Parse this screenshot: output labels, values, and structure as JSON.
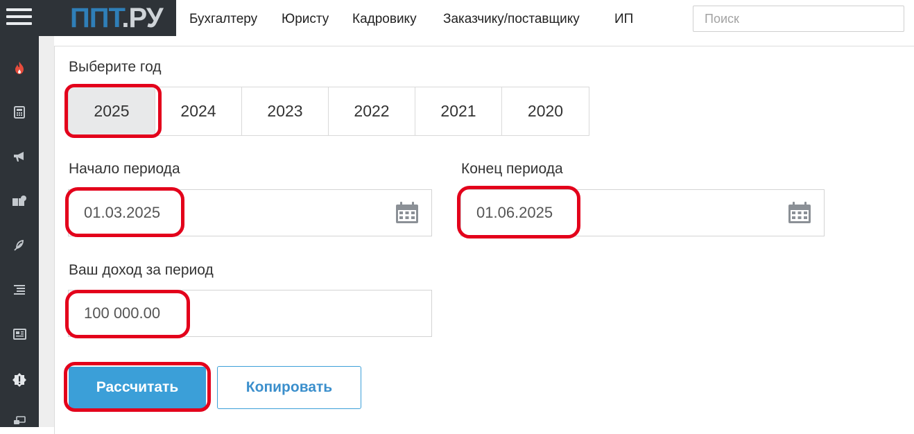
{
  "logo": {
    "part1": "ППТ",
    "part2": ".РУ"
  },
  "sidebar": {
    "icons": [
      "fire-icon",
      "calculator-icon",
      "megaphone-icon",
      "books-icon",
      "feather-icon",
      "list-icon",
      "newspaper-icon",
      "alert-badge-icon",
      "chat-icon"
    ]
  },
  "nav": {
    "items": [
      "Бухгалтеру",
      "Юристу",
      "Кадровику",
      "Заказчику/поставщику",
      "ИП"
    ],
    "search_placeholder": "Поиск"
  },
  "form": {
    "year_label": "Выберите год",
    "years": [
      "2025",
      "2024",
      "2023",
      "2022",
      "2021",
      "2020"
    ],
    "selected_year": "2025",
    "start_label": "Начало периода",
    "start_value": "01.03.2025",
    "end_label": "Конец периода",
    "end_value": "01.06.2025",
    "income_label": "Ваш доход за период",
    "income_value": "100 000.00",
    "calc_button": "Рассчитать",
    "copy_button": "Копировать"
  },
  "colors": {
    "sidebar_bg": "#2e3338",
    "accent_blue": "#3b9fd8",
    "highlight_red": "#e3001b",
    "fire_icon": "#e74c3c"
  }
}
